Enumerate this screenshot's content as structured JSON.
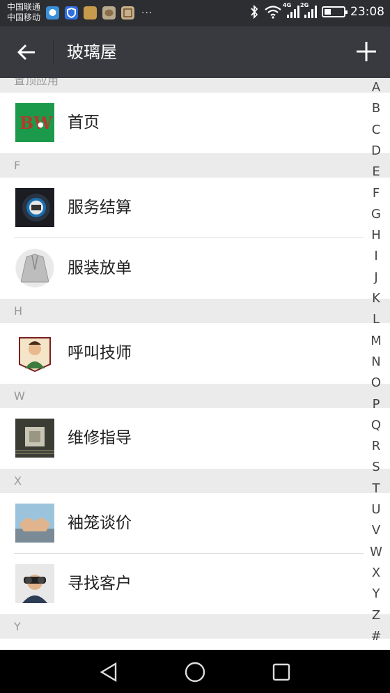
{
  "status_bar": {
    "carrier_1": "中国联通",
    "carrier_2": "中国移动",
    "more_indicator": "···",
    "network_1": "4G",
    "network_2": "2G",
    "time": "23:08",
    "battery_level": 0.35,
    "notification_icons": [
      "qq-icon",
      "shield-app-icon",
      "app-icon",
      "chat-app-icon",
      "gallery-icon"
    ]
  },
  "app_bar": {
    "title": "玻璃屋",
    "back_icon": "arrow-left-icon",
    "add_icon": "plus-icon"
  },
  "list": {
    "top_partial_header": "置顶应用",
    "sections": [
      {
        "header": "",
        "items": [
          {
            "label": "首页",
            "icon": "homepage-logo-icon"
          }
        ]
      },
      {
        "header": "F",
        "items": [
          {
            "label": "服务结算",
            "icon": "service-button-icon"
          },
          {
            "label": "服装放单",
            "icon": "suit-jacket-icon"
          }
        ]
      },
      {
        "header": "H",
        "items": [
          {
            "label": "呼叫技师",
            "icon": "technician-icon"
          }
        ]
      },
      {
        "header": "W",
        "items": [
          {
            "label": "维修指导",
            "icon": "circuit-board-icon"
          }
        ]
      },
      {
        "header": "X",
        "items": [
          {
            "label": "袖笼谈价",
            "icon": "handshake-icon"
          },
          {
            "label": "寻找客户",
            "icon": "binoculars-icon"
          }
        ]
      },
      {
        "header": "Y",
        "items": []
      }
    ]
  },
  "index_bar": [
    "A",
    "B",
    "C",
    "D",
    "E",
    "F",
    "G",
    "H",
    "I",
    "J",
    "K",
    "L",
    "M",
    "N",
    "O",
    "P",
    "Q",
    "R",
    "S",
    "T",
    "U",
    "V",
    "W",
    "X",
    "Y",
    "Z",
    "#"
  ],
  "nav_bar": {
    "back_icon": "triangle-back-icon",
    "home_icon": "circle-home-icon",
    "recent_icon": "square-recent-icon"
  }
}
